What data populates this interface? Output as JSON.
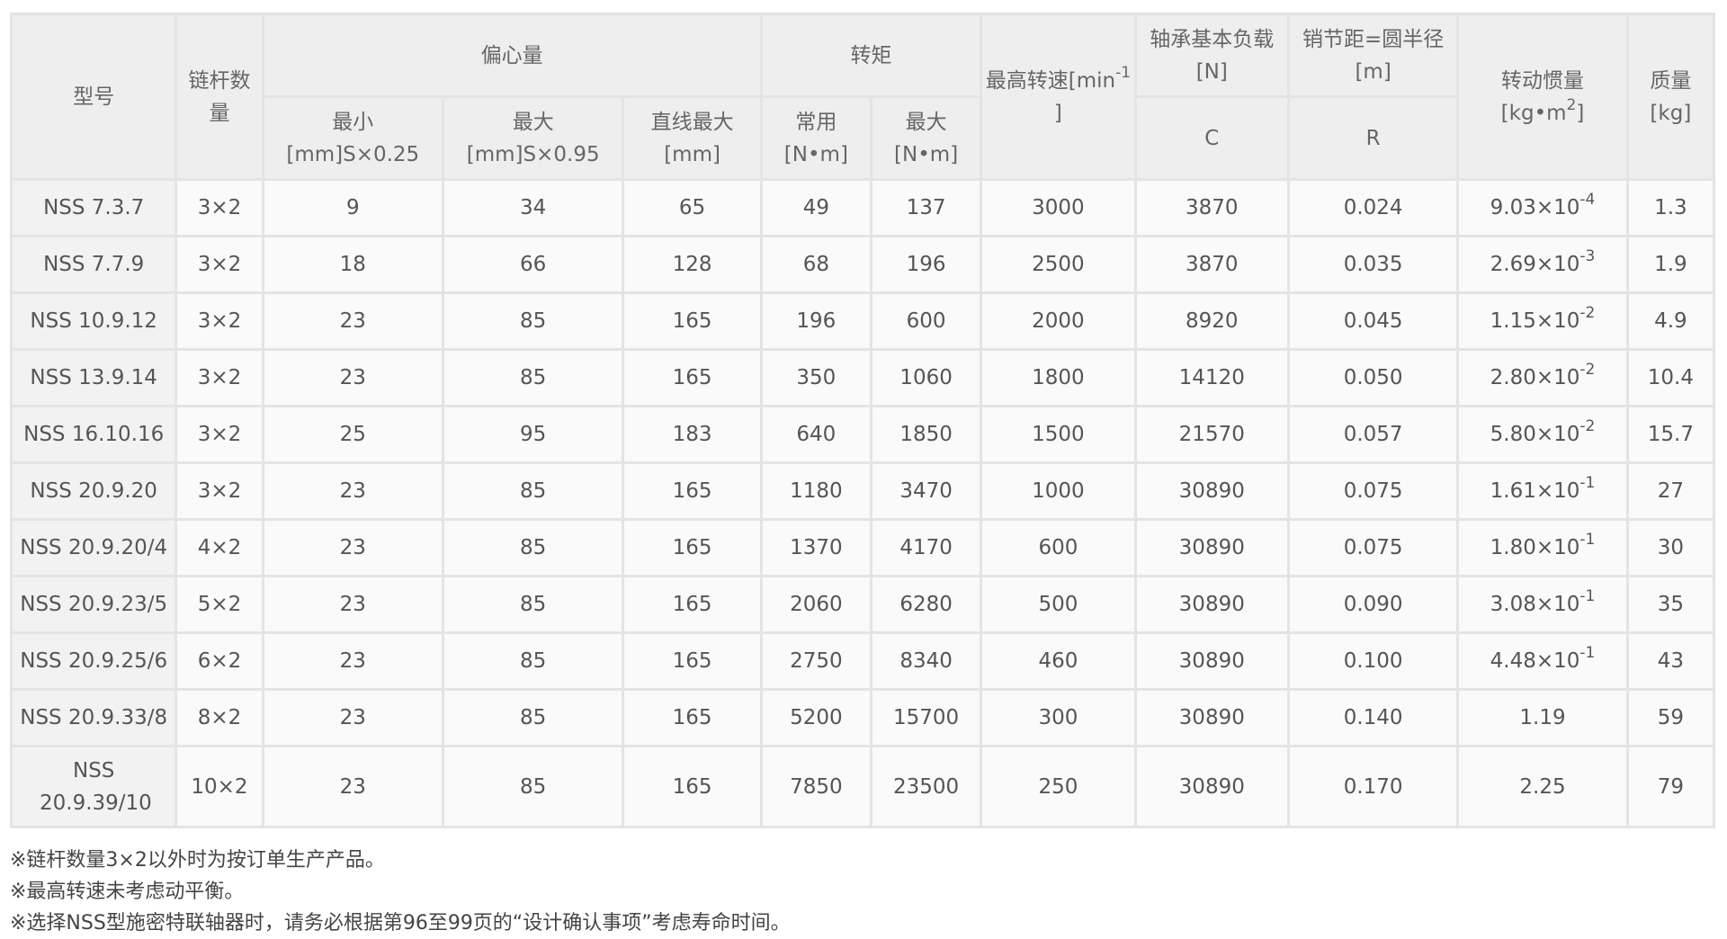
{
  "headers": {
    "model": "型号",
    "links": "链杆数量",
    "eccentric": "偏心量",
    "eccentric_min": "最小",
    "eccentric_min_unit": "[mm]S×0.25",
    "eccentric_max": "最大",
    "eccentric_max_unit": "[mm]S×0.95",
    "eccentric_line": "直线最大",
    "eccentric_line_unit": "[mm]",
    "torque": "转矩",
    "torque_normal": "常用",
    "torque_normal_unit": "[N•m]",
    "torque_max": "最大",
    "torque_max_unit": "[N•m]",
    "speed_a": "最高转速[min",
    "speed_sup": "-1",
    "speed_b": "]",
    "bearing": "轴承基本负载",
    "bearing_unit": "[N]",
    "bearing_sub": "C",
    "pitch": "销节距=圆半径",
    "pitch_unit": "[m]",
    "pitch_sub": "R",
    "inertia": "转动惯量",
    "inertia_unit_a": "[kg•m",
    "inertia_unit_sup": "2",
    "inertia_unit_b": "]",
    "mass": "质量",
    "mass_unit": "[kg]"
  },
  "rows": [
    {
      "model": "NSS 7.3.7",
      "links": "3×2",
      "min": "9",
      "max": "34",
      "line": "65",
      "tn": "49",
      "tm": "137",
      "speed": "3000",
      "c": "3870",
      "r": "0.024",
      "i_base": "9.03×10",
      "i_exp": "-4",
      "mass": "1.3"
    },
    {
      "model": "NSS 7.7.9",
      "links": "3×2",
      "min": "18",
      "max": "66",
      "line": "128",
      "tn": "68",
      "tm": "196",
      "speed": "2500",
      "c": "3870",
      "r": "0.035",
      "i_base": "2.69×10",
      "i_exp": "-3",
      "mass": "1.9"
    },
    {
      "model": "NSS 10.9.12",
      "links": "3×2",
      "min": "23",
      "max": "85",
      "line": "165",
      "tn": "196",
      "tm": "600",
      "speed": "2000",
      "c": "8920",
      "r": "0.045",
      "i_base": "1.15×10",
      "i_exp": "-2",
      "mass": "4.9"
    },
    {
      "model": "NSS 13.9.14",
      "links": "3×2",
      "min": "23",
      "max": "85",
      "line": "165",
      "tn": "350",
      "tm": "1060",
      "speed": "1800",
      "c": "14120",
      "r": "0.050",
      "i_base": "2.80×10",
      "i_exp": "-2",
      "mass": "10.4"
    },
    {
      "model": "NSS 16.10.16",
      "links": "3×2",
      "min": "25",
      "max": "95",
      "line": "183",
      "tn": "640",
      "tm": "1850",
      "speed": "1500",
      "c": "21570",
      "r": "0.057",
      "i_base": "5.80×10",
      "i_exp": "-2",
      "mass": "15.7"
    },
    {
      "model": "NSS 20.9.20",
      "links": "3×2",
      "min": "23",
      "max": "85",
      "line": "165",
      "tn": "1180",
      "tm": "3470",
      "speed": "1000",
      "c": "30890",
      "r": "0.075",
      "i_base": "1.61×10",
      "i_exp": "-1",
      "mass": "27"
    },
    {
      "model": "NSS 20.9.20/4",
      "links": "4×2",
      "min": "23",
      "max": "85",
      "line": "165",
      "tn": "1370",
      "tm": "4170",
      "speed": "600",
      "c": "30890",
      "r": "0.075",
      "i_base": "1.80×10",
      "i_exp": "-1",
      "mass": "30"
    },
    {
      "model": "NSS 20.9.23/5",
      "links": "5×2",
      "min": "23",
      "max": "85",
      "line": "165",
      "tn": "2060",
      "tm": "6280",
      "speed": "500",
      "c": "30890",
      "r": "0.090",
      "i_base": "3.08×10",
      "i_exp": "-1",
      "mass": "35"
    },
    {
      "model": "NSS 20.9.25/6",
      "links": "6×2",
      "min": "23",
      "max": "85",
      "line": "165",
      "tn": "2750",
      "tm": "8340",
      "speed": "460",
      "c": "30890",
      "r": "0.100",
      "i_base": "4.48×10",
      "i_exp": "-1",
      "mass": "43"
    },
    {
      "model": "NSS 20.9.33/8",
      "links": "8×2",
      "min": "23",
      "max": "85",
      "line": "165",
      "tn": "5200",
      "tm": "15700",
      "speed": "300",
      "c": "30890",
      "r": "0.140",
      "i_base": "1.19",
      "i_exp": "",
      "mass": "59"
    },
    {
      "model": "NSS 20.9.39/10",
      "links": "10×2",
      "min": "23",
      "max": "85",
      "line": "165",
      "tn": "7850",
      "tm": "23500",
      "speed": "250",
      "c": "30890",
      "r": "0.170",
      "i_base": "2.25",
      "i_exp": "",
      "mass": "79"
    }
  ],
  "notes": [
    "※链杆数量3×2以外时为按订单生产产品。",
    "※最高转速未考虑动平衡。",
    "※选择NSS型施密特联轴器时，请务必根据第96至99页的“设计确认事项”考虑寿命时间。"
  ]
}
